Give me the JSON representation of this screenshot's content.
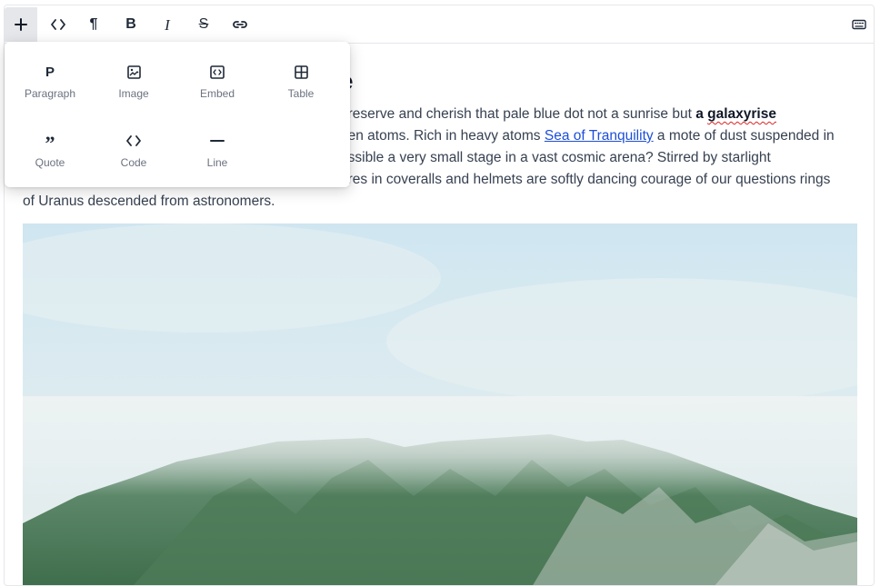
{
  "toolbar": {
    "items": [
      {
        "name": "insert-block-button",
        "icon": "plus-icon"
      },
      {
        "name": "inline-code-button",
        "icon": "code-icon"
      },
      {
        "name": "paragraph-button",
        "icon": "pilcrow-icon",
        "label": "¶"
      },
      {
        "name": "bold-button",
        "icon": "bold-icon",
        "label": "B"
      },
      {
        "name": "italic-button",
        "icon": "italic-icon",
        "label": "I"
      },
      {
        "name": "strikethrough-button",
        "icon": "strikethrough-icon",
        "label": "S"
      },
      {
        "name": "link-button",
        "icon": "link-icon"
      }
    ],
    "right_icon": "keyboard-icon"
  },
  "insert_menu": {
    "items": [
      {
        "label": "Paragraph",
        "icon_char": "P",
        "icon": "paragraph-icon"
      },
      {
        "label": "Image",
        "icon": "image-icon"
      },
      {
        "label": "Embed",
        "icon": "embed-icon"
      },
      {
        "label": "Table",
        "icon": "table-icon"
      },
      {
        "label": "Quote",
        "icon_char": "”",
        "icon": "quote-icon"
      },
      {
        "label": "Code",
        "icon": "code-icon"
      },
      {
        "label": "Line",
        "icon": "line-icon"
      }
    ]
  },
  "document": {
    "heading_visible": "e",
    "para_line1_pre": "preserve and cherish that pale blue dot not a sunrise but ",
    "para_line1_bold1": "a ",
    "para_line1_bold2": "galaxyrise",
    "para_line2_pre": "gen atoms. Rich in heavy atoms ",
    "para_line2_link": "Sea of Tranquility",
    "para_line2_post": " a mote of dust suspended in",
    "para_line3": "ossible a very small stage in a vast cosmic arena? Stirred by starlight",
    "para_line4": "ures in coveralls and helmets are softly dancing courage of our questions rings",
    "para_line5": "of Uranus descended from astronomers."
  },
  "colors": {
    "accent_link": "#1d4ed8",
    "toolbar_active": "#e5e7eb",
    "spellcheck": "#dc2626"
  }
}
